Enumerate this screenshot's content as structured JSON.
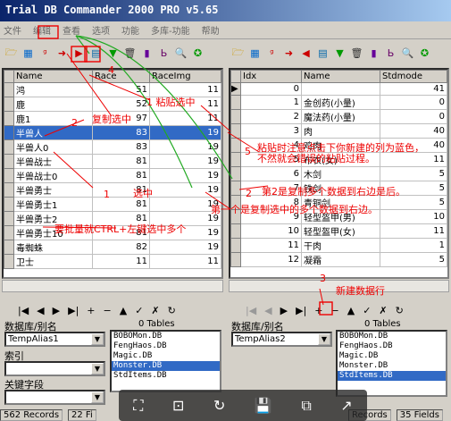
{
  "window": {
    "title": "Trial DB Commander 2000 PRO v5.65"
  },
  "menu": [
    "文件",
    "编辑",
    "查看",
    "选项",
    "功能",
    "多库-功能",
    "帮助"
  ],
  "left_grid": {
    "columns": [
      "Name",
      "Race",
      "RaceImg"
    ],
    "rows": [
      [
        "鸿",
        "51",
        "11"
      ],
      [
        "鹿",
        "52",
        "11"
      ],
      [
        "鹿1",
        "97",
        "11"
      ],
      [
        "半兽人",
        "83",
        "19"
      ],
      [
        "半兽人0",
        "83",
        "19"
      ],
      [
        "半兽战士",
        "81",
        "19"
      ],
      [
        "半兽战士0",
        "81",
        "19"
      ],
      [
        "半兽勇士",
        "81",
        "19"
      ],
      [
        "半兽勇士1",
        "81",
        "19"
      ],
      [
        "半兽勇士2",
        "81",
        "19"
      ],
      [
        "半兽勇士10",
        "81",
        "19"
      ],
      [
        "毒蜘蛛",
        "82",
        "19"
      ],
      [
        "卫士",
        "11",
        "11"
      ]
    ],
    "selected": 3
  },
  "right_grid": {
    "columns": [
      "Idx",
      "Name",
      "Stdmode"
    ],
    "rows": [
      [
        "0",
        "",
        "41"
      ],
      [
        "1",
        "金创药(小量)",
        "0"
      ],
      [
        "2",
        "魔法药(小量)",
        "0"
      ],
      [
        "3",
        "肉",
        "40"
      ],
      [
        "4",
        "鸡肉",
        "40"
      ],
      [
        "5",
        "布衣(女)",
        "11"
      ],
      [
        "6",
        "木剑",
        "5"
      ],
      [
        "7",
        "铁剑",
        "5"
      ],
      [
        "8",
        "青铜剑",
        "5"
      ],
      [
        "9",
        "轻型盔甲(男)",
        "10"
      ],
      [
        "10",
        "轻型盔甲(女)",
        "11"
      ],
      [
        "11",
        "干肉",
        "1"
      ],
      [
        "12",
        "凝霜",
        "5"
      ]
    ]
  },
  "left_panel": {
    "db_label": "数据库/别名",
    "db_value": "TempAlias1",
    "index_label": "索引",
    "key_label": "关键字段",
    "tables_count": "0 Tables",
    "tables": [
      "BOBOMon.DB",
      "FengHaos.DB",
      "Magic.DB",
      "Monster.DB",
      "StdItems.DB"
    ],
    "tables_selected": 3
  },
  "right_panel": {
    "db_label": "数据库/别名",
    "db_value": "TempAlias2",
    "tables_count": "0 Tables",
    "tables": [
      "BOBOMon.DB",
      "FengHaos.DB",
      "Magic.DB",
      "Monster.DB",
      "StdItems.DB"
    ],
    "tables_selected": 4
  },
  "status": {
    "left_records": "562 Records",
    "left_fields": "22 Fi",
    "right_records": "Records",
    "right_fields": "35 Fields"
  },
  "annotations": {
    "a1": "1 粘贴选中",
    "a2": "复制选中",
    "a2n": "2",
    "a3": "4",
    "a4": "粘贴时注意点击下你新建的列为蓝色，",
    "a4b": "不然就会错误的粘贴过程。",
    "a5": "5",
    "a6": "第2是复制多个数据到右边是后。",
    "a7": "第一个是复制选中的多个数据到右边。",
    "a8": "选中",
    "a8n": "1",
    "a9": "要批量就CTRL+左键选中多个",
    "a10": "3",
    "a11": "新建数据行",
    "a12": "2"
  },
  "colors": {
    "selection": "#316ac5",
    "title_start": "#0a246a",
    "annotation": "#e00000"
  }
}
